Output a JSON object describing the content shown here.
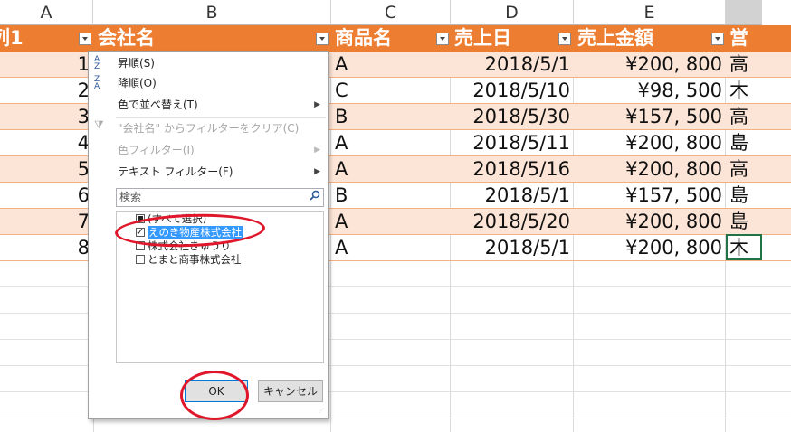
{
  "columns": [
    "A",
    "B",
    "C",
    "D",
    "E",
    ""
  ],
  "table_header": {
    "col_a": "列1",
    "col_b": "会社名",
    "col_c": "商品名",
    "col_d": "売上日",
    "col_e": "売上金額",
    "col_f": "営"
  },
  "rows": [
    {
      "num": "1",
      "product": "A",
      "date": "2018/5/1",
      "amount": "¥200, 800",
      "sales": "高"
    },
    {
      "num": "2",
      "product": "C",
      "date": "2018/5/10",
      "amount": "¥98, 500",
      "sales": "木"
    },
    {
      "num": "3",
      "product": "B",
      "date": "2018/5/30",
      "amount": "¥157, 500",
      "sales": "高"
    },
    {
      "num": "4",
      "product": "A",
      "date": "2018/5/11",
      "amount": "¥200, 800",
      "sales": "島"
    },
    {
      "num": "5",
      "product": "A",
      "date": "2018/5/16",
      "amount": "¥200, 800",
      "sales": "高"
    },
    {
      "num": "6",
      "product": "B",
      "date": "2018/5/1",
      "amount": "¥157, 500",
      "sales": "島"
    },
    {
      "num": "7",
      "product": "A",
      "date": "2018/5/20",
      "amount": "¥200, 800",
      "sales": "島"
    },
    {
      "num": "8",
      "product": "A",
      "date": "2018/5/1",
      "amount": "¥200, 800",
      "sales": "木"
    }
  ],
  "menu": {
    "sort_asc": "昇順(S)",
    "sort_desc": "降順(O)",
    "sort_by_color": "色で並べ替え(T)",
    "clear_filter": "\"会社名\" からフィルターをクリア(C)",
    "color_filter": "色フィルター(I)",
    "text_filter": "テキスト フィルター(F)",
    "search_placeholder": "検索",
    "items": [
      {
        "label": "(すべて選択)",
        "state": "partial"
      },
      {
        "label": "えのき物産株式会社",
        "state": "checked"
      },
      {
        "label": "株式会社きゅうり",
        "state": "unchecked"
      },
      {
        "label": "とまと商事株式会社",
        "state": "unchecked"
      }
    ],
    "ok": "OK",
    "cancel": "キャンセル"
  },
  "colors": {
    "header_orange": "#ed7d31",
    "band": "#fce4d6",
    "annotation_red": "#e0162b",
    "selection_blue": "#3399ff"
  }
}
